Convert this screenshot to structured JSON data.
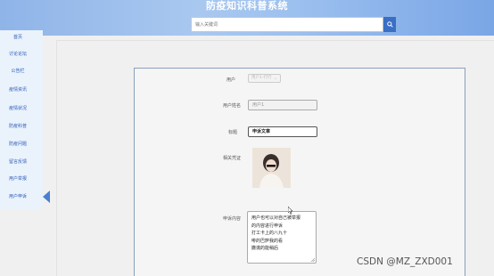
{
  "header": {
    "title": "防疫知识科普系统",
    "search_placeholder": "输入关键词"
  },
  "sidebar": {
    "items": [
      {
        "label": "首页"
      },
      {
        "label": "讨论论坛"
      },
      {
        "label": "公告栏"
      },
      {
        "label": "疫情资讯"
      },
      {
        "label": "疫情状况"
      },
      {
        "label": "防疫科普"
      },
      {
        "label": "防疫问题"
      },
      {
        "label": "留言反馈"
      },
      {
        "label": "用户举报"
      },
      {
        "label": "用户申诉"
      }
    ],
    "active_index": 9
  },
  "form": {
    "user_label": "用户",
    "user_select_value": "用户1-行行",
    "username_label": "用户姓名",
    "username_value": "用户1",
    "title_label": "标题",
    "title_value": "申诉文章",
    "photo_label": "相关凭证",
    "content_label": "申诉内容",
    "content_lines": [
      "用户也可以对自己被举报",
      "的内容进行申诉",
      "打工卡上的八九十",
      "啡的巴萨我的看",
      "撒谎的能稍后"
    ]
  },
  "watermark": "CSDN @MZ_ZXD001",
  "colors": {
    "header_start": "#8fb4e8",
    "accent": "#3a6fc4",
    "sidebar_bg": "#eaf2fc",
    "sidebar_text": "#2a5bb5"
  },
  "icons": {
    "search": "search-icon",
    "active_arrow": "triangle-left-icon"
  }
}
